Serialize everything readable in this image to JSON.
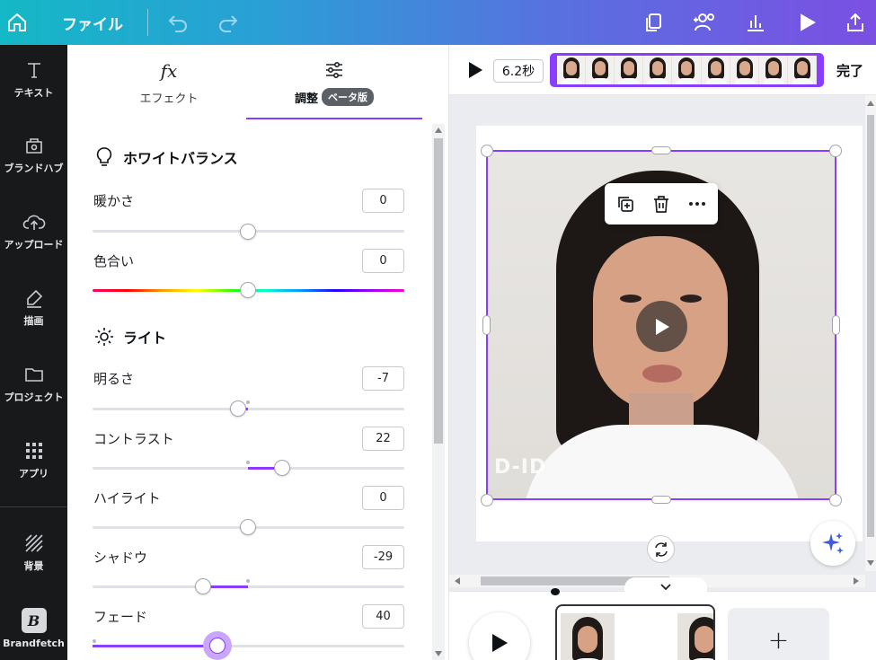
{
  "topbar": {
    "file_label": "ファイル",
    "icons": [
      "home-icon",
      "undo-icon",
      "redo-icon",
      "copy-icon",
      "share-people-icon",
      "stats-icon",
      "play-icon",
      "upload-icon"
    ]
  },
  "rail": {
    "items": [
      {
        "label": "テキスト",
        "icon": "text-icon"
      },
      {
        "label": "ブランドハブ",
        "icon": "brand-hub-icon"
      },
      {
        "label": "アップロード",
        "icon": "cloud-upload-icon"
      },
      {
        "label": "描画",
        "icon": "draw-icon"
      },
      {
        "label": "プロジェクト",
        "icon": "folder-icon"
      },
      {
        "label": "アプリ",
        "icon": "apps-grid-icon"
      },
      {
        "label": "背景",
        "icon": "background-icon"
      },
      {
        "label": "Brandfetch",
        "icon": "brandfetch-icon"
      }
    ]
  },
  "panel": {
    "tabs": [
      {
        "label": "エフェクト",
        "icon_text": "fx"
      },
      {
        "label": "調整",
        "badge": "ベータ版"
      }
    ],
    "white_balance": {
      "title": "ホワイトバランス",
      "warmth": {
        "label": "暖かさ",
        "value": "0",
        "level": 0
      },
      "tint": {
        "label": "色合い",
        "value": "0",
        "level": 0
      }
    },
    "light": {
      "title": "ライト",
      "brightness": {
        "label": "明るさ",
        "value": "-7",
        "level": -7
      },
      "contrast": {
        "label": "コントラスト",
        "value": "22",
        "level": 22
      },
      "highlights": {
        "label": "ハイライト",
        "value": "0",
        "level": 0
      },
      "shadows": {
        "label": "シャドウ",
        "value": "-29",
        "level": -29
      },
      "fade": {
        "label": "フェード",
        "value": "40",
        "level": 40
      }
    }
  },
  "editor": {
    "duration": "6.2秒",
    "done_label": "完了",
    "frame_count": 9,
    "watermark": "D-ID",
    "add_clip": "+",
    "accent": "#8b3dff"
  }
}
